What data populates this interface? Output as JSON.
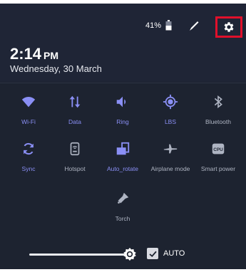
{
  "status": {
    "battery_percent": "41%",
    "time": "2:14",
    "ampm": "PM",
    "date": "Wednesday, 30 March"
  },
  "icons": {
    "battery": "battery-icon",
    "edit": "pencil-icon",
    "settings": "gear-icon"
  },
  "colors": {
    "background": "#1d2330",
    "active": "#8a8ff5",
    "inactive": "#aeb4c2",
    "highlight": "#e0102b"
  },
  "tiles": [
    {
      "label": "Wi-Fi",
      "icon": "wifi-icon",
      "active": true
    },
    {
      "label": "Data",
      "icon": "data-arrows-icon",
      "active": true
    },
    {
      "label": "Ring",
      "icon": "volume-icon",
      "active": true
    },
    {
      "label": "LBS",
      "icon": "location-target-icon",
      "active": true
    },
    {
      "label": "Bluetooth",
      "icon": "bluetooth-icon",
      "active": false
    },
    {
      "label": "Sync",
      "icon": "sync-icon",
      "active": true
    },
    {
      "label": "Hotspot",
      "icon": "hotspot-icon",
      "active": false
    },
    {
      "label": "Auto_rotate",
      "icon": "auto-rotate-icon",
      "active": true
    },
    {
      "label": "Airplane mode",
      "icon": "airplane-icon",
      "active": false
    },
    {
      "label": "Smart power",
      "icon": "cpu-icon",
      "active": false
    },
    {
      "label": "Torch",
      "icon": "torch-icon",
      "active": false
    }
  ],
  "cpu_text": "CPU",
  "brightness": {
    "level": 1.0,
    "auto_label": "AUTO",
    "auto_checked": true
  }
}
